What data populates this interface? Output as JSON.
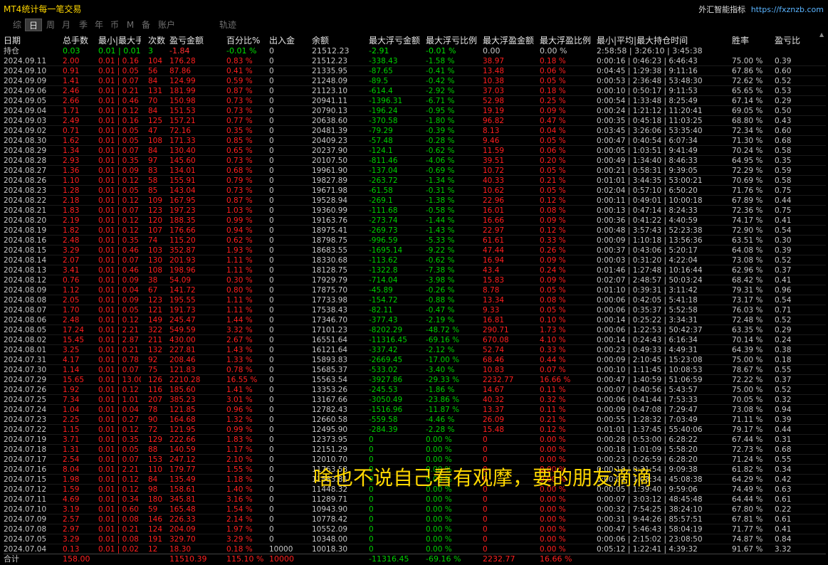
{
  "app": {
    "title": "MT4统计每一笔交易",
    "brand_name": "外汇智能指标",
    "brand_url": "https://fxznzb.com"
  },
  "tabs": [
    "综",
    "日",
    "周",
    "月",
    "季",
    "年",
    "币",
    "M",
    "备",
    "账户",
    "轨迹"
  ],
  "active_tab": 1,
  "headers": [
    "日期",
    "总手数",
    "最小|最大手数",
    "次数",
    "盈亏金额",
    "百分比%",
    "出入金",
    "余额",
    "最大浮亏金额",
    "最大浮亏比例",
    "最大浮盈金额",
    "最大浮盈比例",
    "最小|平均|最大持仓时间",
    "胜率",
    "盈亏比"
  ],
  "holding": [
    "持仓",
    "0.03",
    "0.01 | 0.01",
    "3",
    "-1.84",
    "-0.01 %",
    "0",
    "21512.23",
    "-2.91",
    "-0.01 %",
    "0.00",
    "0.00 %",
    "2:58:58 | 3:26:10 | 3:45:38",
    "",
    ""
  ],
  "rows": [
    [
      "2024.09.11",
      "2.00",
      "0.01 | 0.16",
      "104",
      "176.28",
      "0.83 %",
      "0",
      "21512.23",
      "-338.43",
      "-1.58 %",
      "38.97",
      "0.18 %",
      "0:00:16 | 0:46:23 | 6:46:43",
      "75.00 %",
      "0.39"
    ],
    [
      "2024.09.10",
      "0.91",
      "0.01 | 0.05",
      "56",
      "87.86",
      "0.41 %",
      "0",
      "21335.95",
      "-87.65",
      "-0.41 %",
      "13.48",
      "0.06 %",
      "0:04:45 | 1:29:38 | 9:11:16",
      "67.86 %",
      "0.60"
    ],
    [
      "2024.09.09",
      "1.41",
      "0.01 | 0.07",
      "84",
      "124.99",
      "0.59 %",
      "0",
      "21248.09",
      "-89.5",
      "-0.42 %",
      "10.38",
      "0.05 %",
      "0:00:53 | 2:36:48 | 53:48:30",
      "72.62 %",
      "0.52"
    ],
    [
      "2024.09.06",
      "2.46",
      "0.01 | 0.21",
      "131",
      "181.99",
      "0.87 %",
      "0",
      "21123.10",
      "-614.4",
      "-2.92 %",
      "37.03",
      "0.18 %",
      "0:00:10 | 0:50:17 | 9:11:53",
      "65.65 %",
      "0.53"
    ],
    [
      "2024.09.05",
      "2.66",
      "0.01 | 0.46",
      "70",
      "150.98",
      "0.73 %",
      "0",
      "20941.11",
      "-1396.31",
      "-6.71 %",
      "52.98",
      "0.25 %",
      "0:00:54 | 1:33:48 | 8:25:49",
      "67.14 %",
      "0.29"
    ],
    [
      "2024.09.04",
      "1.71",
      "0.01 | 0.12",
      "84",
      "151.53",
      "0.73 %",
      "0",
      "20790.13",
      "-196.24",
      "-0.95 %",
      "19.19",
      "0.09 %",
      "0:00:24 | 1:21:12 | 11:20:41",
      "69.05 %",
      "0.50"
    ],
    [
      "2024.09.03",
      "2.49",
      "0.01 | 0.16",
      "125",
      "157.21",
      "0.77 %",
      "0",
      "20638.60",
      "-370.58",
      "-1.80 %",
      "96.82",
      "0.47 %",
      "0:00:35 | 0:45:18 | 11:03:25",
      "68.80 %",
      "0.43"
    ],
    [
      "2024.09.02",
      "0.71",
      "0.01 | 0.05",
      "47",
      "72.16",
      "0.35 %",
      "0",
      "20481.39",
      "-79.29",
      "-0.39 %",
      "8.13",
      "0.04 %",
      "0:03:45 | 3:26:06 | 53:35:40",
      "72.34 %",
      "0.60"
    ],
    [
      "2024.08.30",
      "1.62",
      "0.01 | 0.05",
      "108",
      "171.33",
      "0.85 %",
      "0",
      "20409.23",
      "-57.48",
      "-0.28 %",
      "9.46",
      "0.05 %",
      "0:00:47 | 0:40:54 | 6:07:34",
      "71.30 %",
      "0.68"
    ],
    [
      "2024.08.29",
      "1.34",
      "0.01 | 0.07",
      "84",
      "130.40",
      "0.65 %",
      "0",
      "20237.90",
      "-124.1",
      "-0.62 %",
      "11.59",
      "0.06 %",
      "0:00:05 | 1:03:51 | 9:41:49",
      "70.24 %",
      "0.58"
    ],
    [
      "2024.08.28",
      "2.93",
      "0.01 | 0.35",
      "97",
      "145.60",
      "0.73 %",
      "0",
      "20107.50",
      "-811.46",
      "-4.06 %",
      "39.51",
      "0.20 %",
      "0:00:49 | 1:34:40 | 8:46:33",
      "64.95 %",
      "0.35"
    ],
    [
      "2024.08.27",
      "1.36",
      "0.01 | 0.09",
      "83",
      "134.01",
      "0.68 %",
      "0",
      "19961.90",
      "-137.04",
      "-0.69 %",
      "10.72",
      "0.05 %",
      "0:00:21 | 0:58:31 | 9:39:05",
      "72.29 %",
      "0.59"
    ],
    [
      "2024.08.26",
      "1.10",
      "0.01 | 0.12",
      "58",
      "155.91",
      "0.79 %",
      "0",
      "19827.89",
      "-263.72",
      "-1.34 %",
      "40.33",
      "0.21 %",
      "0:01:01 | 3:44:35 | 53:00:21",
      "70.69 %",
      "0.58"
    ],
    [
      "2024.08.23",
      "1.28",
      "0.01 | 0.05",
      "85",
      "143.04",
      "0.73 %",
      "0",
      "19671.98",
      "-61.58",
      "-0.31 %",
      "10.62",
      "0.05 %",
      "0:02:04 | 0:57:10 | 6:50:20",
      "71.76 %",
      "0.75"
    ],
    [
      "2024.08.22",
      "2.18",
      "0.01 | 0.12",
      "109",
      "167.95",
      "0.87 %",
      "0",
      "19528.94",
      "-269.1",
      "-1.38 %",
      "22.96",
      "0.12 %",
      "0:00:11 | 0:49:01 | 10:00:18",
      "67.89 %",
      "0.44"
    ],
    [
      "2024.08.21",
      "1.83",
      "0.01 | 0.07",
      "123",
      "197.23",
      "1.03 %",
      "0",
      "19360.99",
      "-111.68",
      "-0.58 %",
      "16.01",
      "0.08 %",
      "0:00:13 | 0:47:14 | 8:24:33",
      "72.36 %",
      "0.75"
    ],
    [
      "2024.08.20",
      "2.19",
      "0.01 | 0.12",
      "120",
      "188.35",
      "0.99 %",
      "0",
      "19163.76",
      "-273.74",
      "-1.44 %",
      "16.66",
      "0.09 %",
      "0:00:36 | 0:41:22 | 4:40:59",
      "74.17 %",
      "0.41"
    ],
    [
      "2024.08.19",
      "1.82",
      "0.01 | 0.12",
      "107",
      "176.66",
      "0.94 %",
      "0",
      "18975.41",
      "-269.73",
      "-1.43 %",
      "22.97",
      "0.12 %",
      "0:00:48 | 3:57:43 | 52:23:38",
      "72.90 %",
      "0.54"
    ],
    [
      "2024.08.16",
      "2.48",
      "0.01 | 0.35",
      "74",
      "115.20",
      "0.62 %",
      "0",
      "18798.75",
      "-996.59",
      "-5.33 %",
      "61.61",
      "0.33 %",
      "0:00:09 | 1:10:18 | 13:56:36",
      "63.51 %",
      "0.30"
    ],
    [
      "2024.08.15",
      "3.29",
      "0.01 | 0.46",
      "103",
      "352.87",
      "1.93 %",
      "0",
      "18683.55",
      "-1695.14",
      "-9.22 %",
      "47.44",
      "0.26 %",
      "0:00:37 | 0:43:06 | 5:20:17",
      "64.08 %",
      "0.39"
    ],
    [
      "2024.08.14",
      "2.07",
      "0.01 | 0.07",
      "130",
      "201.93",
      "1.11 %",
      "0",
      "18330.68",
      "-113.62",
      "-0.62 %",
      "16.94",
      "0.09 %",
      "0:00:03 | 0:31:20 | 4:22:04",
      "73.08 %",
      "0.52"
    ],
    [
      "2024.08.13",
      "3.41",
      "0.01 | 0.46",
      "108",
      "198.96",
      "1.11 %",
      "0",
      "18128.75",
      "-1322.8",
      "-7.38 %",
      "43.4",
      "0.24 %",
      "0:01:46 | 1:27:48 | 10:16:44",
      "62.96 %",
      "0.37"
    ],
    [
      "2024.08.12",
      "0.76",
      "0.01 | 0.09",
      "38",
      "54.09",
      "0.30 %",
      "0",
      "17929.79",
      "-714.04",
      "-3.98 %",
      "15.83",
      "0.09 %",
      "0:02:07 | 2:48:57 | 50:03:24",
      "68.42 %",
      "0.41"
    ],
    [
      "2024.08.09",
      "1.12",
      "0.01 | 0.04",
      "67",
      "141.72",
      "0.80 %",
      "0",
      "17875.70",
      "-45.89",
      "-0.26 %",
      "8.78",
      "0.05 %",
      "0:01:10 | 0:39:31 | 3:11:42",
      "79.31 %",
      "0.96"
    ],
    [
      "2024.08.08",
      "2.05",
      "0.01 | 0.09",
      "123",
      "195.55",
      "1.11 %",
      "0",
      "17733.98",
      "-154.72",
      "-0.88 %",
      "13.34",
      "0.08 %",
      "0:00:06 | 0:42:05 | 5:41:18",
      "73.17 %",
      "0.54"
    ],
    [
      "2024.08.07",
      "1.70",
      "0.01 | 0.05",
      "121",
      "191.73",
      "1.11 %",
      "0",
      "17538.43",
      "-82.11",
      "-0.47 %",
      "9.33",
      "0.05 %",
      "0:00:06 | 0:35:37 | 5:52:58",
      "76.03 %",
      "0.71"
    ],
    [
      "2024.08.06",
      "2.48",
      "0.01 | 0.12",
      "149",
      "245.47",
      "1.44 %",
      "0",
      "17346.70",
      "-377.43",
      "-2.19 %",
      "16.81",
      "0.10 %",
      "0:00:14 | 0:25:22 | 3:34:31",
      "72.48 %",
      "0.52"
    ],
    [
      "2024.08.05",
      "17.24",
      "0.01 | 2.21",
      "322",
      "549.59",
      "3.32 %",
      "0",
      "17101.23",
      "-8202.29",
      "-48.72 %",
      "290.71",
      "1.73 %",
      "0:00:06 | 1:22:53 | 50:42:37",
      "63.35 %",
      "0.29"
    ],
    [
      "2024.08.02",
      "15.45",
      "0.01 | 2.87",
      "211",
      "430.00",
      "2.67 %",
      "0",
      "16551.64",
      "-11316.45",
      "-69.16 %",
      "670.08",
      "4.10 %",
      "0:00:14 | 0:24:43 | 6:16:34",
      "70.14 %",
      "0.24"
    ],
    [
      "2024.08.01",
      "3.25",
      "0.01 | 0.21",
      "132",
      "227.81",
      "1.43 %",
      "0",
      "16121.64",
      "-337.42",
      "-2.12 %",
      "52.74",
      "0.33 %",
      "0:00:23 | 0:49:33 | 4:49:31",
      "64.39 %",
      "0.38"
    ],
    [
      "2024.07.31",
      "4.17",
      "0.01 | 0.78",
      "92",
      "208.46",
      "1.33 %",
      "0",
      "15893.83",
      "-2669.45",
      "-17.00 %",
      "68.46",
      "0.44 %",
      "0:00:09 | 2:10:45 | 15:23:08",
      "75.00 %",
      "0.18"
    ],
    [
      "2024.07.30",
      "1.14",
      "0.01 | 0.07",
      "75",
      "121.83",
      "0.78 %",
      "0",
      "15685.37",
      "-533.02",
      "-3.40 %",
      "10.83",
      "0.07 %",
      "0:00:10 | 1:11:45 | 10:08:53",
      "78.67 %",
      "0.55"
    ],
    [
      "2024.07.29",
      "15.65",
      "0.01 | 13.00",
      "126",
      "2210.28",
      "16.55 %",
      "0",
      "15563.54",
      "-3927.86",
      "-29.33 %",
      "2232.77",
      "16.66 %",
      "0:00:47 | 1:40:59 | 51:06:59",
      "72.22 %",
      "0.37"
    ],
    [
      "2024.07.26",
      "1.92",
      "0.01 | 0.12",
      "116",
      "185.60",
      "1.41 %",
      "0",
      "13353.26",
      "-245.53",
      "-1.86 %",
      "14.67",
      "0.11 %",
      "0:00:07 | 0:40:56 | 5:43:57",
      "75.00 %",
      "0.52"
    ],
    [
      "2024.07.25",
      "7.34",
      "0.01 | 1.01",
      "207",
      "385.23",
      "3.01 %",
      "0",
      "13167.66",
      "-3050.49",
      "-23.86 %",
      "40.32",
      "0.32 %",
      "0:00:06 | 0:41:44 | 7:53:33",
      "70.05 %",
      "0.32"
    ],
    [
      "2024.07.24",
      "1.04",
      "0.01 | 0.04",
      "78",
      "121.85",
      "0.96 %",
      "0",
      "12782.43",
      "-1516.96",
      "-11.87 %",
      "13.37",
      "0.11 %",
      "0:00:09 | 0:47:08 | 7:29:47",
      "73.08 %",
      "0.94"
    ],
    [
      "2024.07.23",
      "2.25",
      "0.01 | 0.27",
      "90",
      "164.68",
      "1.32 %",
      "0",
      "12660.58",
      "-559.58",
      "-4.46 %",
      "26.09",
      "0.21 %",
      "0:00:55 | 1:28:32 | 7:03:49",
      "71.11 %",
      "0.39"
    ],
    [
      "2024.07.22",
      "1.15",
      "0.01 | 0.12",
      "72",
      "121.95",
      "0.99 %",
      "0",
      "12495.90",
      "-284.39",
      "-2.28 %",
      "15.48",
      "0.12 %",
      "0:01:01 | 1:37:45 | 55:40:06",
      "79.17 %",
      "0.44"
    ],
    [
      "2024.07.19",
      "3.71",
      "0.01 | 0.35",
      "129",
      "222.66",
      "1.83 %",
      "0",
      "12373.95",
      "0",
      "0.00 %",
      "0",
      "0.00 %",
      "0:00:28 | 0:53:00 | 6:28:22",
      "67.44 %",
      "0.31"
    ],
    [
      "2024.07.18",
      "1.31",
      "0.01 | 0.05",
      "88",
      "140.59",
      "1.17 %",
      "0",
      "12151.29",
      "0",
      "0.00 %",
      "0",
      "0.00 %",
      "0:00:18 | 1:01:09 | 5:58:20",
      "72.73 %",
      "0.68"
    ],
    [
      "2024.07.17",
      "2.54",
      "0.01 | 0.07",
      "153",
      "247.12",
      "2.10 %",
      "0",
      "12010.70",
      "0",
      "0.00 %",
      "0",
      "0.00 %",
      "0:00:23 | 0:26:59 | 6:28:20",
      "71.24 %",
      "0.55"
    ],
    [
      "2024.07.16",
      "8.04",
      "0.01 | 2.21",
      "110",
      "179.77",
      "1.55 %",
      "0",
      "11763.58",
      "0",
      "0.00 %",
      "0",
      "0.00 %",
      "0:00:18 | 0:31:54 | 9:09:38",
      "61.82 %",
      "0.34"
    ],
    [
      "2024.07.15",
      "1.98",
      "0.01 | 0.12",
      "84",
      "135.49",
      "1.18 %",
      "0",
      "11583.81",
      "0",
      "0.00 %",
      "0",
      "0.00 %",
      "0:00:01 | 1:03:34 | 45:08:38",
      "64.29 %",
      "0.42"
    ],
    [
      "2024.07.12",
      "1.59",
      "0.01 | 0.12",
      "98",
      "158.61",
      "1.40 %",
      "0",
      "11448.32",
      "0",
      "0.00 %",
      "0",
      "0.00 %",
      "0:00:05 | 1:39:40 | 9:59:06",
      "74.49 %",
      "0.63"
    ],
    [
      "2024.07.11",
      "4.69",
      "0.01 | 0.34",
      "180",
      "345.81",
      "3.16 %",
      "0",
      "11289.71",
      "0",
      "0.00 %",
      "0",
      "0.00 %",
      "0:00:07 | 3:03:12 | 48:45:48",
      "64.44 %",
      "0.61"
    ],
    [
      "2024.07.10",
      "3.19",
      "0.01 | 0.60",
      "59",
      "165.48",
      "1.54 %",
      "0",
      "10943.90",
      "0",
      "0.00 %",
      "0",
      "0.00 %",
      "0:00:32 | 7:54:25 | 38:24:10",
      "67.80 %",
      "0.22"
    ],
    [
      "2024.07.09",
      "2.57",
      "0.01 | 0.08",
      "146",
      "226.33",
      "2.14 %",
      "0",
      "10778.42",
      "0",
      "0.00 %",
      "0",
      "0.00 %",
      "0:00:31 | 9:44:26 | 85:57:51",
      "67.81 %",
      "0.61"
    ],
    [
      "2024.07.08",
      "2.97",
      "0.01 | 0.21",
      "124",
      "204.09",
      "1.97 %",
      "0",
      "10552.09",
      "0",
      "0.00 %",
      "0",
      "0.00 %",
      "0:00:47 | 5:46:43 | 58:04:19",
      "71.77 %",
      "0.41"
    ],
    [
      "2024.07.05",
      "3.29",
      "0.01 | 0.08",
      "191",
      "329.70",
      "3.29 %",
      "0",
      "10348.00",
      "0",
      "0.00 %",
      "0",
      "0.00 %",
      "0:00:06 | 2:15:02 | 23:08:50",
      "74.87 %",
      "0.84"
    ],
    [
      "2024.07.04",
      "0.13",
      "0.01 | 0.02",
      "12",
      "18.30",
      "0.18 %",
      "10000",
      "10018.30",
      "0",
      "0.00 %",
      "0",
      "0.00 %",
      "0:05:12 | 1:22:41 | 4:39:32",
      "91.67 %",
      "3.32"
    ]
  ],
  "total": [
    "合计",
    "158.00",
    "",
    "",
    "11510.39",
    "115.10 %",
    "10000",
    "",
    "-11316.45",
    "-69.16 %",
    "2232.77",
    "16.66 %",
    "",
    "",
    ""
  ],
  "overlay_caption": "啥也不说自己看有观摩，要的朋友滴滴"
}
